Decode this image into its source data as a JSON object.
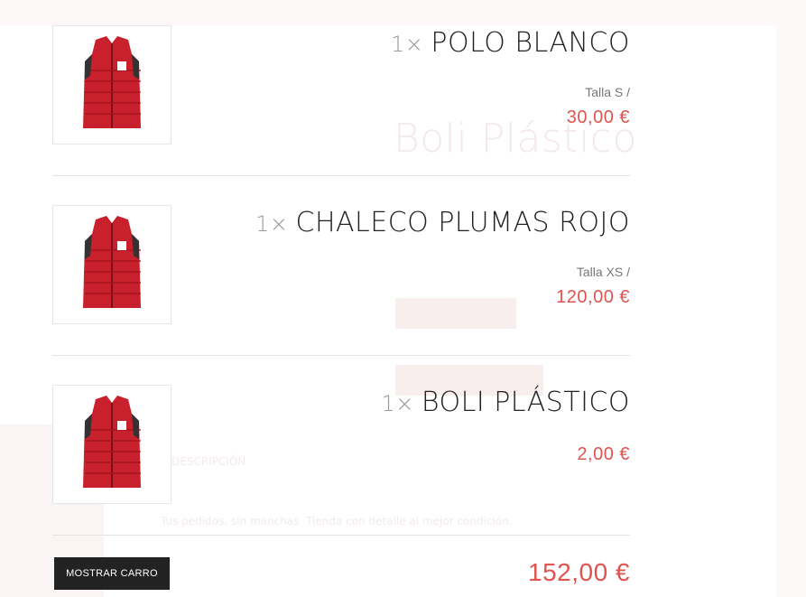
{
  "background": {
    "product_title": "Boli Plástico",
    "tab_label": "DESCRIPCIÓN",
    "paragraph": "Tus pedidos, sin manchas. Tienda con detalle al mejor condición."
  },
  "cart": {
    "items": [
      {
        "qty": "1×",
        "name": "POLO BLANCO",
        "variant": "Talla S /",
        "price": "30,00 €",
        "image": "red-vest-image"
      },
      {
        "qty": "1×",
        "name": "CHALECO PLUMAS ROJO",
        "variant": "Talla XS /",
        "price": "120,00 €",
        "image": "red-vest-image"
      },
      {
        "qty": "1×",
        "name": "BOLI PLÁSTICO",
        "variant": "",
        "price": "2,00 €",
        "image": "red-vest-image"
      }
    ],
    "show_cart_label": "MOSTRAR CARRO",
    "total": "152,00 €"
  },
  "colors": {
    "accent": "#e0534f",
    "button_bg": "#222222"
  }
}
